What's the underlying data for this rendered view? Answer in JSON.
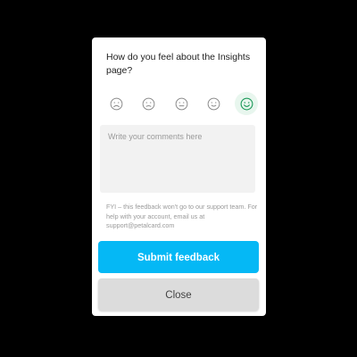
{
  "dialog": {
    "question": "How do you feel about the Insights page?",
    "ratings": [
      {
        "icon": "very-sad-face-icon",
        "selected": false
      },
      {
        "icon": "sad-face-icon",
        "selected": false
      },
      {
        "icon": "neutral-face-icon",
        "selected": false
      },
      {
        "icon": "happy-face-icon",
        "selected": false
      },
      {
        "icon": "very-happy-face-icon",
        "selected": true
      }
    ],
    "comments_placeholder": "Write your comments here",
    "fyi_text": "FYI – this feedback won't go to our support team. For help with your account, email us at support@petalcard.com",
    "submit_label": "Submit feedback",
    "close_label": "Close"
  },
  "colors": {
    "accent": "#05b8f5",
    "face_default": "#8a8a8a",
    "face_selected": "#1d9a5a",
    "close_bg": "#dcdcdc"
  }
}
